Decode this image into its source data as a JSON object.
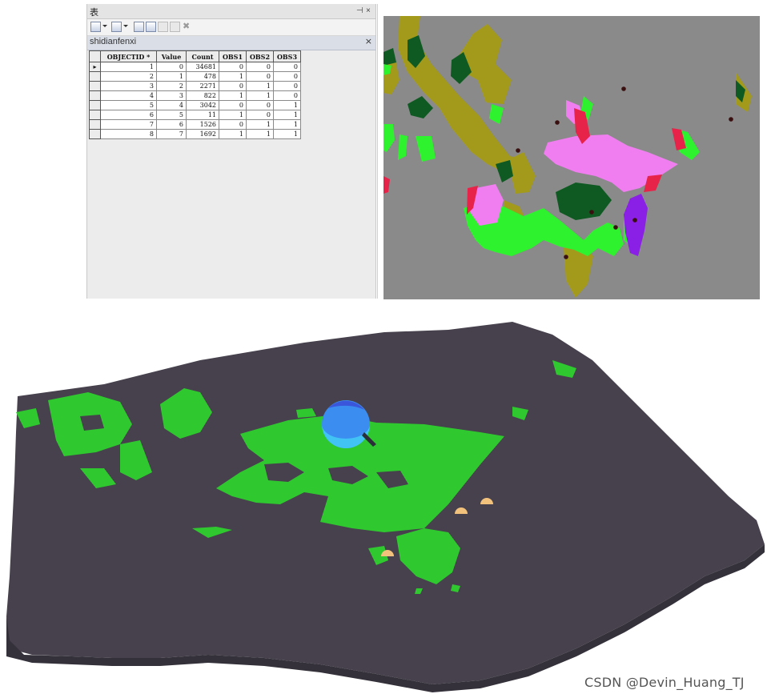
{
  "window": {
    "title": "表",
    "pin_glyph": "⊣",
    "close_glyph": "×"
  },
  "toolbar": {
    "icons": [
      "table-options-icon",
      "related-tables-icon",
      "select-by-attributes-icon",
      "switch-selection-icon",
      "clear-selection-icon",
      "zoom-to-selected-icon",
      "delete-selected-icon"
    ]
  },
  "layer_tab": {
    "name": "shidianfenxi",
    "close_glyph": "×"
  },
  "attribute_table": {
    "columns": [
      "OBJECTID *",
      "Value",
      "Count",
      "OBS1",
      "OBS2",
      "OBS3"
    ],
    "current_row_marker": "▸",
    "rows": [
      [
        "1",
        "0",
        "34681",
        "0",
        "0",
        "0"
      ],
      [
        "2",
        "1",
        "478",
        "1",
        "0",
        "0"
      ],
      [
        "3",
        "2",
        "2271",
        "0",
        "1",
        "0"
      ],
      [
        "4",
        "3",
        "822",
        "1",
        "1",
        "0"
      ],
      [
        "5",
        "4",
        "3042",
        "0",
        "0",
        "1"
      ],
      [
        "6",
        "5",
        "11",
        "1",
        "0",
        "1"
      ],
      [
        "7",
        "6",
        "1526",
        "0",
        "1",
        "1"
      ],
      [
        "8",
        "7",
        "1692",
        "1",
        "1",
        "1"
      ]
    ]
  },
  "map_colors": {
    "background": "#8a8a8a",
    "olive": "#a39a1c",
    "dark_green": "#0f5a22",
    "bright_green": "#2ef22e",
    "pink": "#f07ef0",
    "red": "#e8234a",
    "purple": "#8a1fe6",
    "point": "#3a0f0f"
  },
  "scene_colors": {
    "terrain": "#46414c",
    "green": "#2fc92f",
    "sphere": "#3b8ef0",
    "marker": "#f2c27c"
  },
  "watermark": "CSDN @Devin_Huang_TJ"
}
